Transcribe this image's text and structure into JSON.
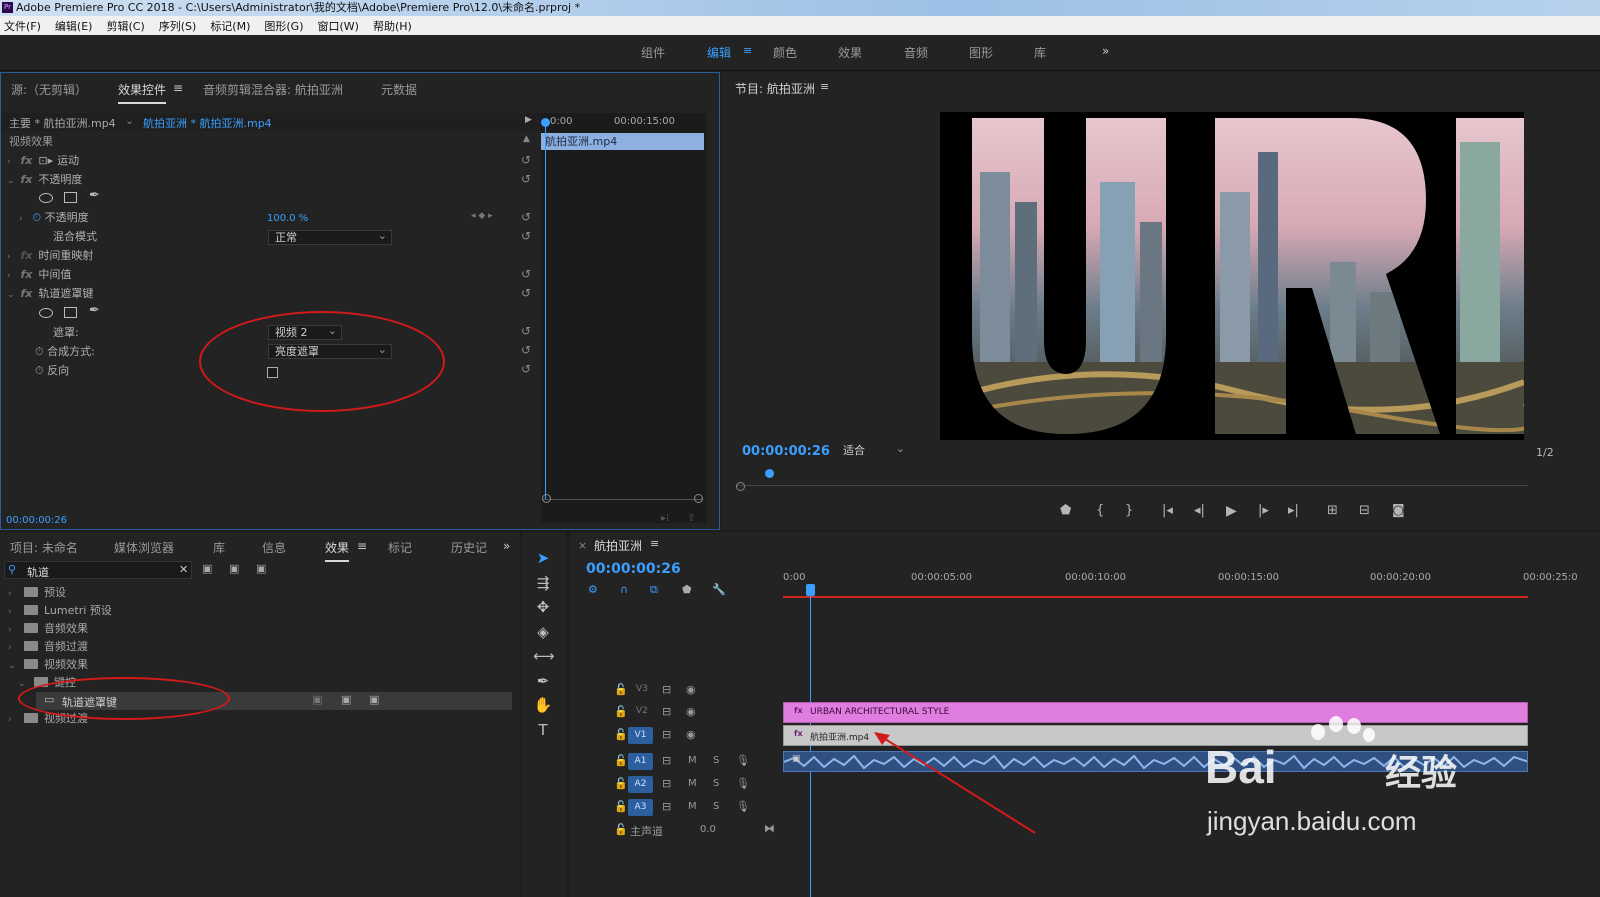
{
  "window": {
    "title": "Adobe Premiere Pro CC 2018 - C:\\Users\\Administrator\\我的文档\\Adobe\\Premiere Pro\\12.0\\未命名.prproj *",
    "app_badge": "Pr"
  },
  "menu": [
    "文件(F)",
    "编辑(E)",
    "剪辑(C)",
    "序列(S)",
    "标记(M)",
    "图形(G)",
    "窗口(W)",
    "帮助(H)"
  ],
  "workspaces": {
    "items": [
      "组件",
      "编辑",
      "颜色",
      "效果",
      "音频",
      "图形",
      "库"
    ],
    "active": "编辑",
    "more": "»"
  },
  "effect_controls": {
    "tabs": [
      "源:（无剪辑）",
      "效果控件",
      "音频剪辑混合器: 航拍亚洲",
      "元数据"
    ],
    "active_tab": "效果控件",
    "master_label": "主要 * 航拍亚洲.mp4",
    "clip_label": "航拍亚洲 * 航拍亚洲.mp4",
    "ruler_start": "0:00",
    "ruler_mid": "00:00:15:00",
    "clip_bar": "航拍亚洲.mp4",
    "section": "视频效果",
    "motion": "运动",
    "opacity": "不透明度",
    "opacity_prop": "不透明度",
    "opacity_value": "100.0 %",
    "blend_mode_label": "混合模式",
    "blend_mode_value": "正常",
    "time_remap": "时间重映射",
    "median": "中间值",
    "track_matte": "轨道遮罩键",
    "matte_label": "遮罩:",
    "matte_value": "视频 2",
    "composite_label": "合成方式:",
    "composite_value": "亮度遮罩",
    "reverse_label": "反向",
    "timecode": "00:00:00:26"
  },
  "program": {
    "title": "节目: 航拍亚洲",
    "timecode": "00:00:00:26",
    "fit": "适合",
    "ratio": "1/2",
    "preview_text": "URB"
  },
  "project": {
    "tabs": [
      "项目: 未命名",
      "媒体浏览器",
      "库",
      "信息",
      "效果",
      "标记",
      "历史记"
    ],
    "active_tab": "效果",
    "more": "»",
    "search_value": "轨道",
    "tree": [
      {
        "label": "预设",
        "level": 0,
        "expanded": false
      },
      {
        "label": "Lumetri 预设",
        "level": 0,
        "expanded": false
      },
      {
        "label": "音频效果",
        "level": 0,
        "expanded": false
      },
      {
        "label": "音频过渡",
        "level": 0,
        "expanded": false
      },
      {
        "label": "视频效果",
        "level": 0,
        "expanded": true
      },
      {
        "label": "键控",
        "level": 1,
        "expanded": true
      },
      {
        "label": "轨道遮罩键",
        "level": 2,
        "selected": true
      },
      {
        "label": "视频过渡",
        "level": 0,
        "expanded": false
      }
    ]
  },
  "timeline": {
    "title": "航拍亚洲",
    "timecode": "00:00:00:26",
    "ruler": [
      "0:00",
      "00:00:05:00",
      "00:00:10:00",
      "00:00:15:00",
      "00:00:20:00",
      "00:00:25:0"
    ],
    "tracks_video": [
      "V3",
      "V2",
      "V1"
    ],
    "tracks_audio": [
      "A1",
      "A2",
      "A3"
    ],
    "audio_btns": [
      "M",
      "S"
    ],
    "master": "主声道",
    "master_value": "0.0",
    "clip_v2": "URBAN ARCHITECTURAL STYLE",
    "clip_v1": "航拍亚洲.mp4",
    "colors": {
      "v2_clip": "#e07ee0",
      "v1_clip": "#c8c8c8",
      "audio_clip": "#4a78b8",
      "accent": "#3a9fff",
      "annotation": "#d31a1a"
    }
  },
  "watermark": {
    "brand": "Bai",
    "cn": "经验",
    "url": "jingyan.baidu.com"
  }
}
